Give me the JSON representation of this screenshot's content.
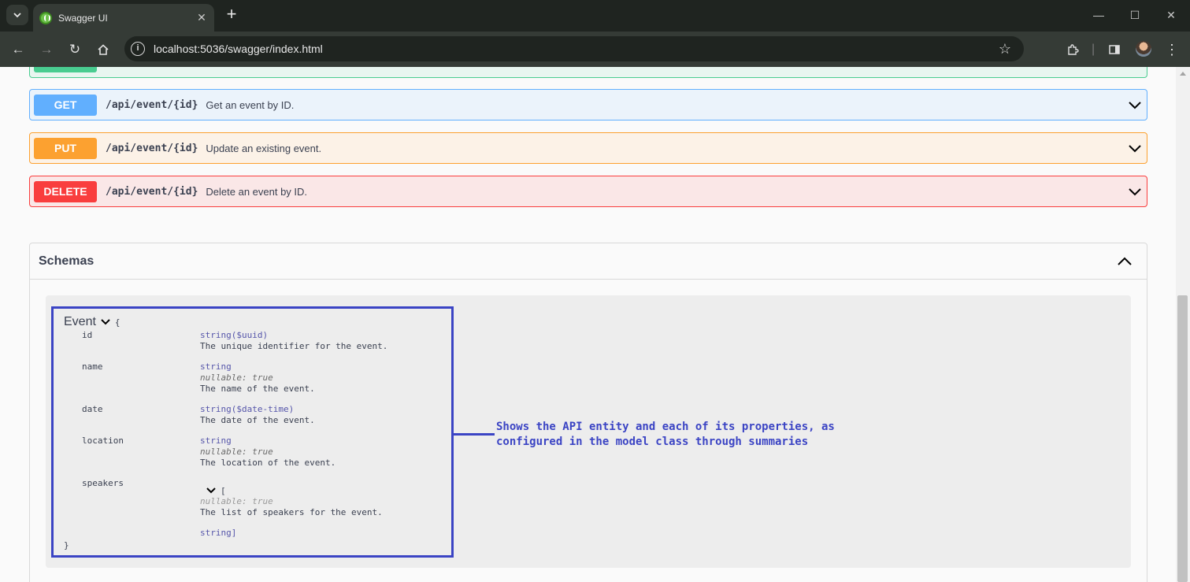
{
  "browser": {
    "tab_title": "Swagger UI",
    "url": "localhost:5036/swagger/index.html"
  },
  "operations": [
    {
      "method": "GET",
      "path": "/api/event/{id}",
      "summary": "Get an event by ID."
    },
    {
      "method": "PUT",
      "path": "/api/event/{id}",
      "summary": "Update an existing event."
    },
    {
      "method": "DELETE",
      "path": "/api/event/{id}",
      "summary": "Delete an event by ID."
    }
  ],
  "schemas": {
    "title": "Schemas",
    "model": {
      "name": "Event",
      "open_brace": "{",
      "close_brace": "}",
      "properties": {
        "id": {
          "name": "id",
          "type": "string($uuid)",
          "description": "The unique identifier for the event."
        },
        "name": {
          "name": "name",
          "type": "string",
          "nullable": "nullable: true",
          "description": "The name of the event."
        },
        "date": {
          "name": "date",
          "type": "string($date-time)",
          "description": "The date of the event."
        },
        "location": {
          "name": "location",
          "type": "string",
          "nullable": "nullable: true",
          "description": "The location of the event."
        },
        "speakers": {
          "name": "speakers",
          "open_bracket": "[",
          "nullable": "nullable: true",
          "description": "The list of speakers for the event.",
          "item_type": "string]"
        }
      }
    }
  },
  "annotation": {
    "line1": "Shows the API entity and each of its properties, as",
    "line2": "configured in the model class through summaries"
  },
  "colors": {
    "get": "#61affe",
    "put": "#fca130",
    "delete": "#f93e3e",
    "post": "#49cc90",
    "annotation": "#3b44c4"
  }
}
